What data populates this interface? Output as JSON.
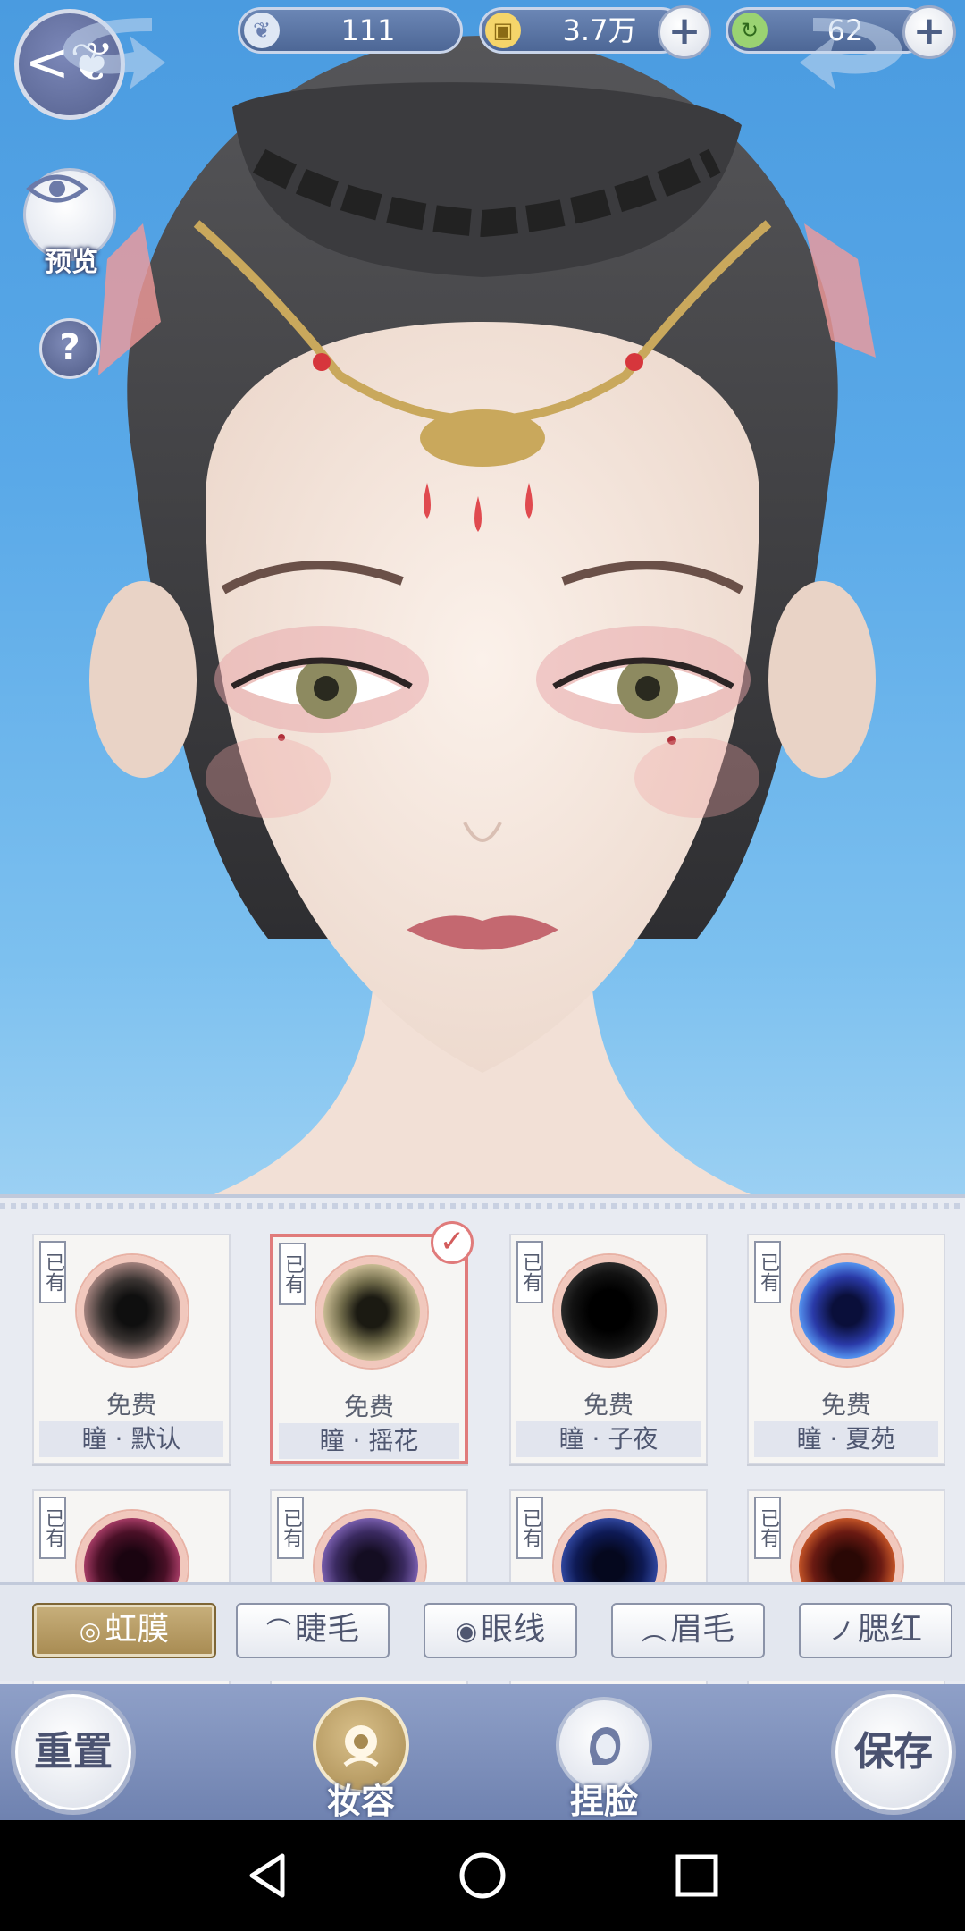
{
  "resources": {
    "jade": {
      "value": "111",
      "icon": "silver-leaf-icon"
    },
    "coins": {
      "value": "3.7万",
      "icon": "coin-icon"
    },
    "energy": {
      "value": "62",
      "icon": "green-swirl-icon"
    }
  },
  "sidebar": {
    "preview_label": "预览",
    "help_label": "?"
  },
  "items": [
    {
      "owned": "已有",
      "price": "免费",
      "name": "瞳 · 默认",
      "color": "#3a3432",
      "ring": "#b48f8a",
      "selected": false
    },
    {
      "owned": "已有",
      "price": "免费",
      "name": "瞳 · 摇花",
      "color": "#6f6a49",
      "ring": "#d8c9a0",
      "selected": true
    },
    {
      "owned": "已有",
      "price": "免费",
      "name": "瞳 · 子夜",
      "color": "#121212",
      "ring": "#3a3a3a",
      "selected": false
    },
    {
      "owned": "已有",
      "price": "免费",
      "name": "瞳 · 夏苑",
      "color": "#2a3aa8",
      "ring": "#5fa7ff",
      "selected": false
    },
    {
      "owned": "已有",
      "color": "#4a1027",
      "ring": "#c44a7a"
    },
    {
      "owned": "已有",
      "color": "#3a2a60",
      "ring": "#8e70c8"
    },
    {
      "owned": "已有",
      "color": "#0e1a55",
      "ring": "#3c56b8"
    },
    {
      "owned": "已有",
      "color": "#6a1a12",
      "ring": "#e2682e"
    }
  ],
  "tabs": [
    {
      "label": "虹膜",
      "icon": "◎",
      "active": true
    },
    {
      "label": "睫毛",
      "icon": "⌒",
      "active": false
    },
    {
      "label": "眼线",
      "icon": "◉",
      "active": false
    },
    {
      "label": "眉毛",
      "icon": "︵",
      "active": false
    },
    {
      "label": "腮红",
      "icon": "ノ",
      "active": false
    }
  ],
  "bottom": {
    "reset_label": "重置",
    "makeup_label": "妆容",
    "face_label": "捏脸",
    "save_label": "保存"
  }
}
